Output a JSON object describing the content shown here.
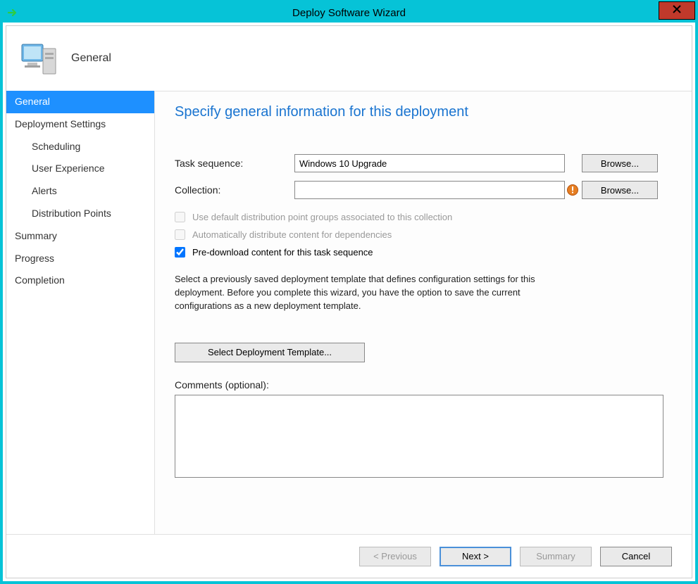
{
  "window": {
    "title": "Deploy Software Wizard",
    "header_label": "General"
  },
  "sidebar": {
    "items": [
      {
        "label": "General",
        "selected": true,
        "indent": false
      },
      {
        "label": "Deployment Settings",
        "selected": false,
        "indent": false
      },
      {
        "label": "Scheduling",
        "selected": false,
        "indent": true
      },
      {
        "label": "User Experience",
        "selected": false,
        "indent": true
      },
      {
        "label": "Alerts",
        "selected": false,
        "indent": true
      },
      {
        "label": "Distribution Points",
        "selected": false,
        "indent": true
      },
      {
        "label": "Summary",
        "selected": false,
        "indent": false
      },
      {
        "label": "Progress",
        "selected": false,
        "indent": false
      },
      {
        "label": "Completion",
        "selected": false,
        "indent": false
      }
    ]
  },
  "main": {
    "heading": "Specify general information for this deployment",
    "task_sequence_label": "Task sequence:",
    "task_sequence_value": "Windows 10 Upgrade",
    "collection_label": "Collection:",
    "collection_value": "",
    "browse_label": "Browse...",
    "check_default_dp": "Use default distribution point groups associated to this collection",
    "check_auto_dist": "Automatically distribute content for dependencies",
    "check_predownload": "Pre-download content for this task sequence",
    "help_text": "Select a previously saved deployment template that defines configuration settings for this deployment. Before you complete this wizard, you have the option to save the current configurations as a new deployment template.",
    "template_btn": "Select Deployment Template...",
    "comments_label": "Comments (optional):",
    "comments_value": ""
  },
  "footer": {
    "previous": "< Previous",
    "next": "Next >",
    "summary": "Summary",
    "cancel": "Cancel"
  }
}
